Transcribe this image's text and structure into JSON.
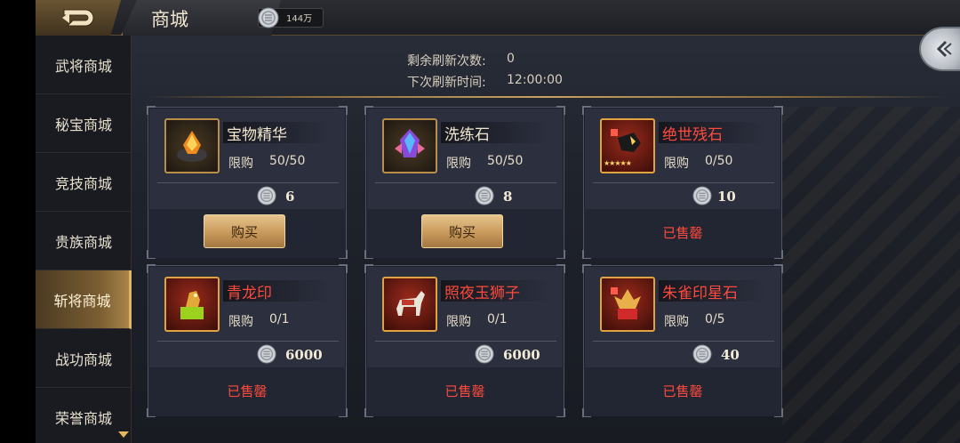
{
  "header": {
    "title": "商城",
    "currency": {
      "icon": "silver-coin-icon",
      "amount": "144万"
    }
  },
  "sidebar": {
    "items": [
      {
        "label": "武将商城",
        "active": false
      },
      {
        "label": "秘宝商城",
        "active": false
      },
      {
        "label": "竞技商城",
        "active": false
      },
      {
        "label": "贵族商城",
        "active": false
      },
      {
        "label": "斩将商城",
        "active": true
      },
      {
        "label": "战功商城",
        "active": false
      },
      {
        "label": "荣誉商城",
        "active": false
      }
    ]
  },
  "refresh": {
    "remaining_label": "剩余刷新次数:",
    "remaining_value": "0",
    "next_label": "下次刷新时间:",
    "next_value": "12:00:00"
  },
  "shop": {
    "limit_label": "限购",
    "buy_label": "购买",
    "sold_label": "已售罄",
    "items": [
      {
        "name": "宝物精华",
        "name_color": "#f0e6cf",
        "limit": "50/50",
        "price": "6",
        "status": "buy",
        "icon": "essence-crystal-icon"
      },
      {
        "name": "洗练石",
        "name_color": "#f0e6cf",
        "limit": "50/50",
        "price": "8",
        "status": "buy",
        "icon": "refine-gem-icon"
      },
      {
        "name": "绝世残石",
        "name_color": "#ff4a3d",
        "limit": "0/50",
        "price": "10",
        "status": "sold",
        "icon": "fragment-stone-icon",
        "stars": "★★★★★"
      },
      {
        "name": "青龙印",
        "name_color": "#ff4a3d",
        "limit": "0/1",
        "price": "6000",
        "status": "sold",
        "icon": "dragon-seal-icon"
      },
      {
        "name": "照夜玉狮子",
        "name_color": "#ff4a3d",
        "limit": "0/1",
        "price": "6000",
        "status": "sold",
        "icon": "white-horse-icon"
      },
      {
        "name": "朱雀印星石",
        "name_color": "#ff4a3d",
        "limit": "0/5",
        "price": "40",
        "status": "sold",
        "icon": "phoenix-seal-icon"
      }
    ]
  }
}
